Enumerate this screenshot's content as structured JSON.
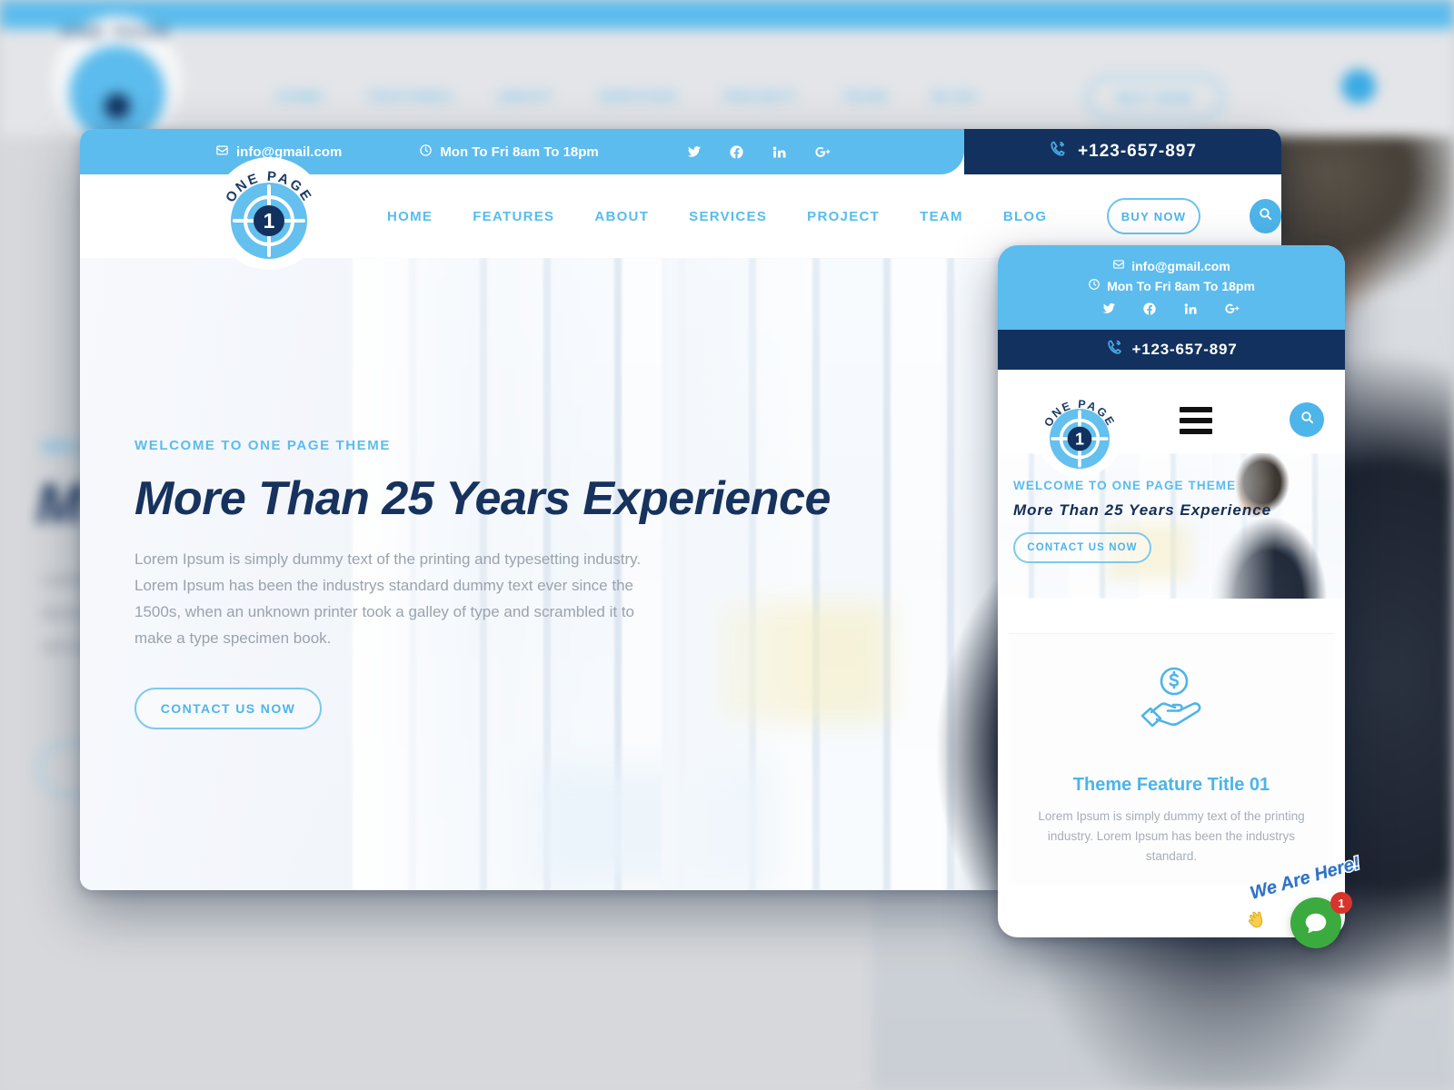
{
  "background": {
    "topbar_color": "#5cbced",
    "nav": [
      "HOME",
      "FEATURES",
      "ABOUT",
      "SERVICES",
      "PROJECT",
      "TEAM",
      "BLOG"
    ],
    "buy_now": "BUY NOW",
    "logo_text": "ONE PAGE",
    "hero_sub": "WELCOME TO ONE PAGE THEME",
    "hero_title": "M",
    "hero_text": "Lorem Ipsum is simply dummy text of the printing and typesetting industry."
  },
  "desktop": {
    "topbar": {
      "email": "info@gmail.com",
      "hours": "Mon To Fri 8am To 18pm",
      "phone": "+123-657-897",
      "socials": [
        {
          "name": "twitter-icon",
          "label": "Twitter"
        },
        {
          "name": "facebook-icon",
          "label": "Facebook"
        },
        {
          "name": "linkedin-icon",
          "label": "LinkedIn"
        },
        {
          "name": "google-plus-icon",
          "label": "Google Plus"
        }
      ]
    },
    "logo": {
      "arc_text": "ONE PAGE",
      "number": "1"
    },
    "nav": {
      "items": [
        "HOME",
        "FEATURES",
        "ABOUT",
        "SERVICES",
        "PROJECT",
        "TEAM",
        "BLOG"
      ],
      "buy_now": "BUY NOW",
      "search_icon": "search-icon"
    },
    "hero": {
      "subtitle": "WELCOME TO ONE PAGE THEME",
      "title": "More Than 25 Years Experience",
      "paragraph": "Lorem Ipsum is simply dummy text of the printing and typesetting industry. Lorem Ipsum has been the industrys standard dummy text ever since the 1500s, when an unknown printer took a galley of type and scrambled it to make a type specimen book.",
      "cta": "CONTACT US NOW"
    }
  },
  "mobile": {
    "topbar": {
      "email": "info@gmail.com",
      "hours": "Mon To Fri 8am To 18pm",
      "phone": "+123-657-897"
    },
    "logo": {
      "arc_text": "ONE PAGE",
      "number": "1"
    },
    "nav": {
      "menu_icon": "hamburger-menu-icon",
      "search_icon": "search-icon"
    },
    "hero": {
      "subtitle": "WELCOME TO ONE PAGE THEME",
      "title": "More Than 25 Years Experience",
      "cta": "CONTACT US NOW"
    },
    "feature": {
      "icon": "hand-holding-dollar-icon",
      "title": "Theme Feature Title 01",
      "text": "Lorem Ipsum is simply dummy text of the printing industry. Lorem Ipsum has been the industrys standard."
    }
  },
  "chat_widget": {
    "label": "We Are Here!",
    "badge_count": "1",
    "hand_icon": "waving-hand-icon",
    "bubble_icon": "chat-bubble-icon"
  },
  "colors": {
    "primary_blue": "#5cbced",
    "dark_navy": "#12315e",
    "accent_light": "#64c0ee",
    "text_grey": "#9aa3ad"
  }
}
